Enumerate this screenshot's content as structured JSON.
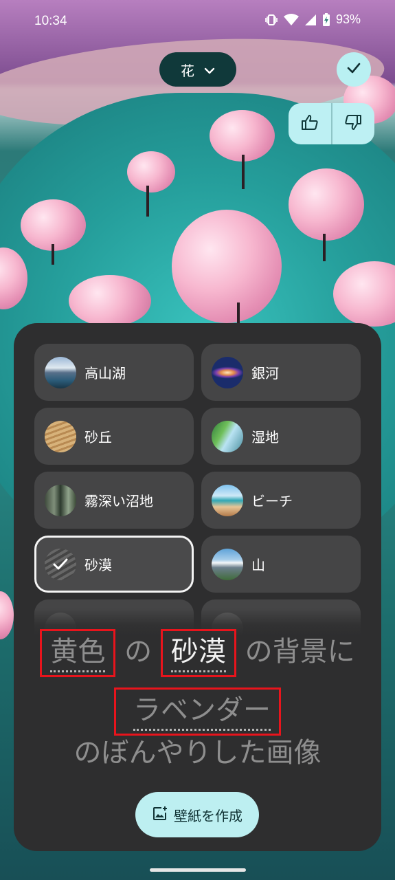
{
  "status_bar": {
    "time": "10:34",
    "battery": "93%"
  },
  "top": {
    "category": "花"
  },
  "styles": [
    {
      "label": "高山湖",
      "icon": "alpine-lake-thumbnail"
    },
    {
      "label": "銀河",
      "icon": "galaxy-thumbnail"
    },
    {
      "label": "砂丘",
      "icon": "sand-dune-thumbnail"
    },
    {
      "label": "湿地",
      "icon": "wetland-thumbnail"
    },
    {
      "label": "霧深い沼地",
      "icon": "misty-swamp-thumbnail"
    },
    {
      "label": "ビーチ",
      "icon": "beach-thumbnail"
    },
    {
      "label": "砂漠",
      "icon": "desert-thumbnail",
      "selected": true
    },
    {
      "label": "山",
      "icon": "mountain-thumbnail"
    }
  ],
  "prompt": {
    "color_word": "黄色",
    "no1": "の",
    "scene_word": "砂漠",
    "suffix1": "の背景に",
    "subject_word": "ラベンダー",
    "line3": "のぼんやりした画像"
  },
  "create_button": {
    "label": "壁紙を作成"
  },
  "colors": {
    "accent": "#bdeff1",
    "sheet": "#2e2e2f",
    "tile": "#454546",
    "highlight_box": "#e8141c"
  }
}
